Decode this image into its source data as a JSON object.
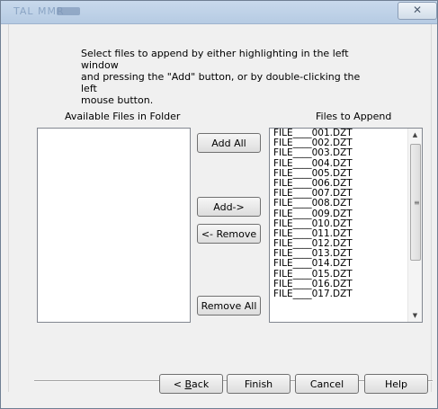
{
  "window": {
    "title": "TAL MMR",
    "close_label": "✕"
  },
  "instructions": "Select files to append by either highlighting in the left window\nand pressing the \"Add\" button, or by double-clicking the left\nmouse button.",
  "available": {
    "header": "Available Files in Folder",
    "items": []
  },
  "append": {
    "header": "Files to Append",
    "items": [
      "FILE____001.DZT",
      "FILE____002.DZT",
      "FILE____003.DZT",
      "FILE____004.DZT",
      "FILE____005.DZT",
      "FILE____006.DZT",
      "FILE____007.DZT",
      "FILE____008.DZT",
      "FILE____009.DZT",
      "FILE____010.DZT",
      "FILE____011.DZT",
      "FILE____012.DZT",
      "FILE____013.DZT",
      "FILE____014.DZT",
      "FILE____015.DZT",
      "FILE____016.DZT",
      "FILE____017.DZT"
    ]
  },
  "buttons": {
    "add_all": "Add All",
    "add": "Add->",
    "remove": "<- Remove",
    "remove_all": "Remove All",
    "back_prefix": "< ",
    "back_mnemonic": "B",
    "back_rest": "ack",
    "finish": "Finish",
    "cancel": "Cancel",
    "help": "Help"
  },
  "scrollbar": {
    "up_icon": "▲",
    "down_icon": "▼",
    "grip_icon": "≡"
  }
}
